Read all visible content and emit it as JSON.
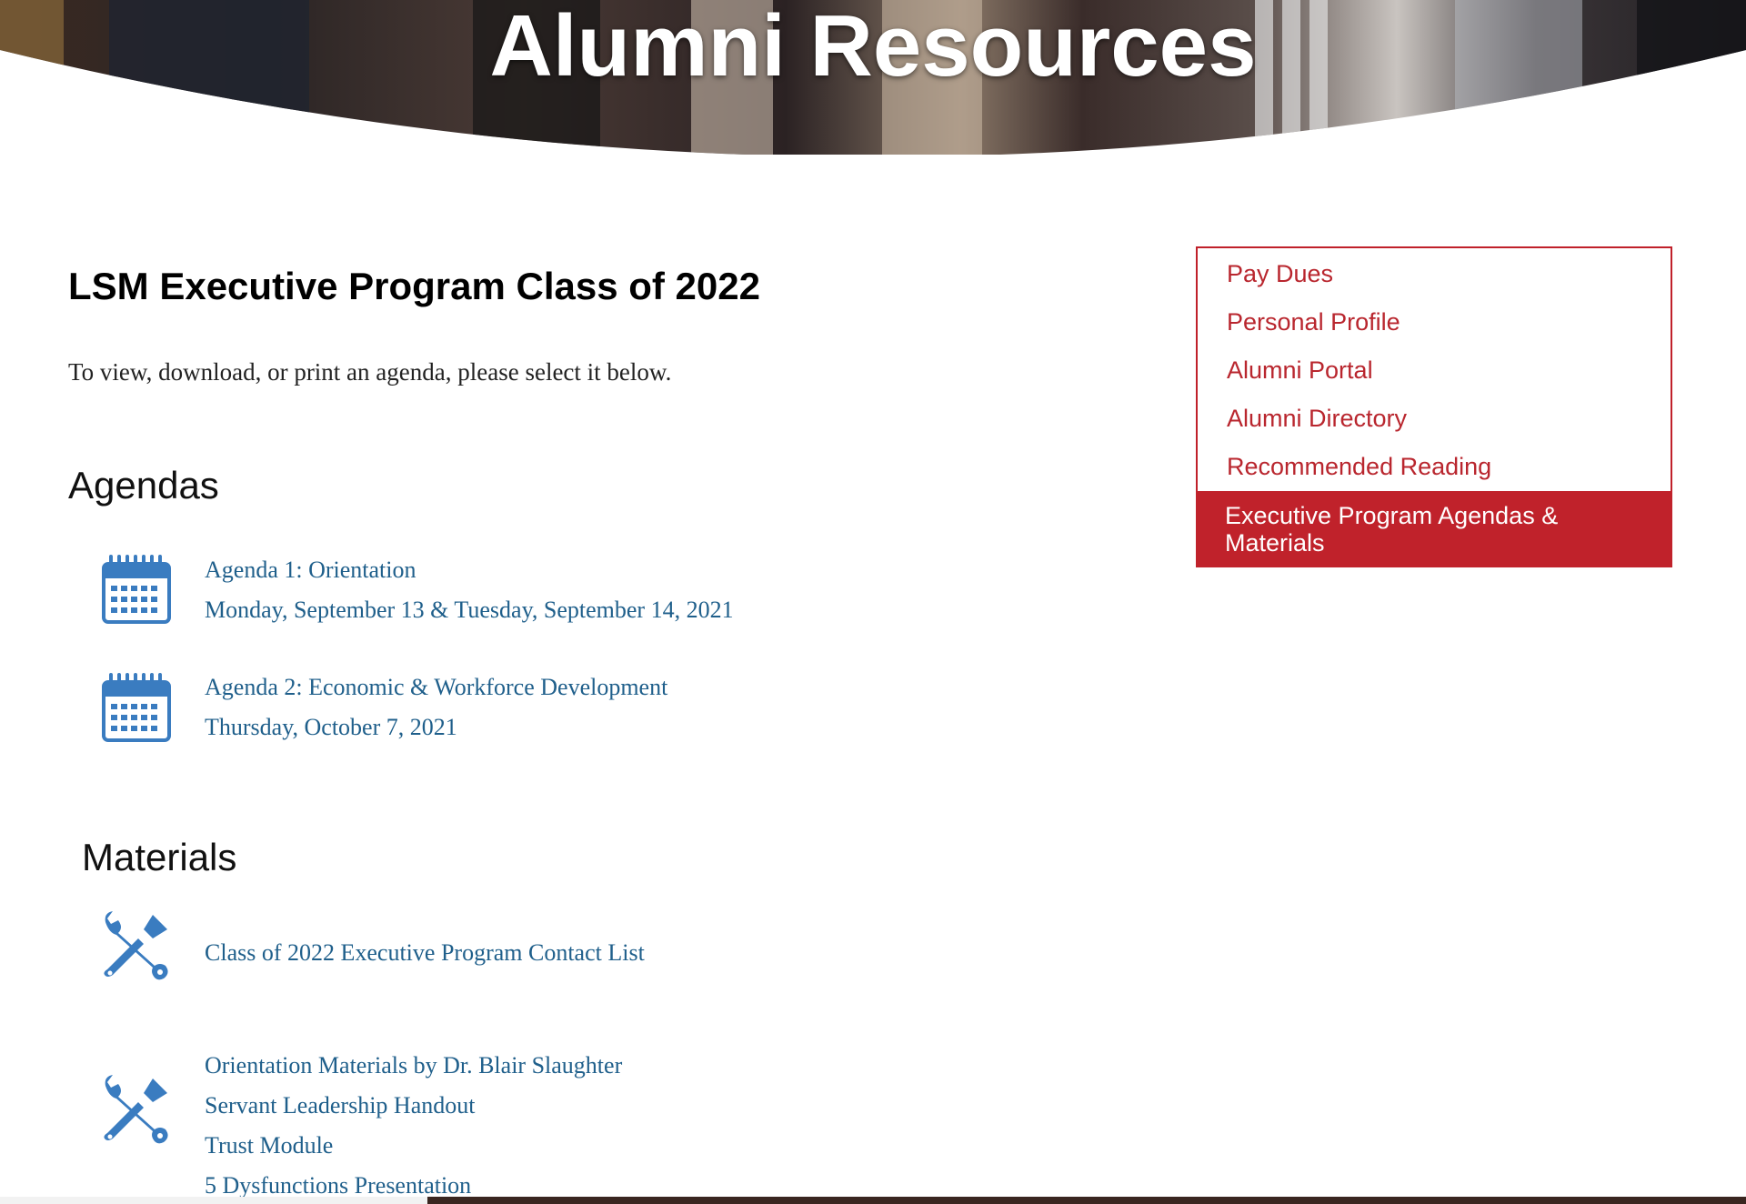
{
  "hero": {
    "title": "Alumni Resources"
  },
  "main": {
    "heading": "LSM Executive Program Class of 2022",
    "intro": "To view, download, or print an agenda, please select it below.",
    "agendas": {
      "heading": "Agendas",
      "icon": "calendar-icon",
      "items": [
        {
          "title": "Agenda 1: Orientation",
          "date": "Monday, September 13 & Tuesday, September 14, 2021"
        },
        {
          "title": "Agenda 2: Economic & Workforce Development",
          "date": "Thursday, October 7, 2021"
        }
      ]
    },
    "materials": {
      "heading": "Materials",
      "icon": "tools-icon",
      "items": [
        {
          "links": [
            "Class of 2022 Executive Program Contact List"
          ]
        },
        {
          "links": [
            "Orientation Materials by Dr. Blair Slaughter",
            "Servant Leadership Handout",
            "Trust Module",
            "5 Dysfunctions Presentation"
          ]
        }
      ]
    }
  },
  "sidebar": {
    "items": [
      {
        "label": "Pay Dues"
      },
      {
        "label": "Personal Profile"
      },
      {
        "label": "Alumni Portal"
      },
      {
        "label": "Alumni Directory"
      },
      {
        "label": "Recommended Reading"
      },
      {
        "label": "Executive Program Agendas & Materials"
      }
    ],
    "active_index": 5
  },
  "colors": {
    "accent_red": "#c0222b",
    "link_blue": "#1f5f8b",
    "icon_blue": "#3a7cc0"
  }
}
